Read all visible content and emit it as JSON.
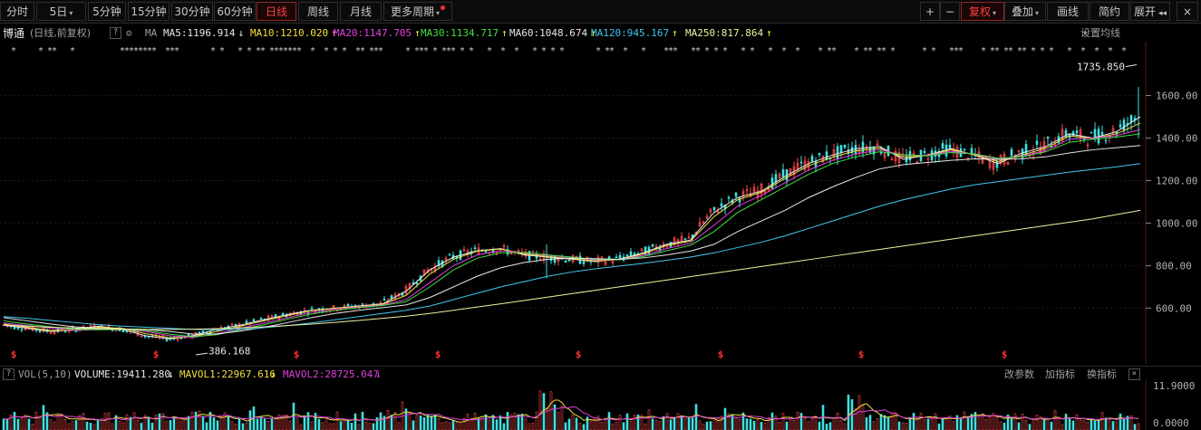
{
  "toolbar": {
    "periods": [
      {
        "label": "分时",
        "active": false
      },
      {
        "label": "5日",
        "active": false,
        "dropdown": true
      },
      {
        "label": "5分钟",
        "active": false
      },
      {
        "label": "15分钟",
        "active": false
      },
      {
        "label": "30分钟",
        "active": false
      },
      {
        "label": "60分钟",
        "active": false
      },
      {
        "label": "日线",
        "active": true
      },
      {
        "label": "周线",
        "active": false
      },
      {
        "label": "月线",
        "active": false
      },
      {
        "label": "更多周期",
        "active": false,
        "dropdown": true,
        "badge": true
      }
    ],
    "zoom_in": "+",
    "zoom_out": "−",
    "right": [
      {
        "label": "复权",
        "active": true,
        "dropdown": true
      },
      {
        "label": "叠加",
        "active": false,
        "dropdown": true
      },
      {
        "label": "画线",
        "active": false
      },
      {
        "label": "简约",
        "active": false
      },
      {
        "label": "展开",
        "active": false
      }
    ],
    "expand_glyph": "◂◂",
    "close_glyph": "×"
  },
  "header": {
    "name": "博通",
    "mode": "(日线,前复权)",
    "help": "?",
    "ma_label": "MA",
    "ma": [
      {
        "text": "MA5:1196.914",
        "arrow": "↓",
        "color": "#e8e8e8"
      },
      {
        "text": "MA10:1210.020",
        "arrow": "↑",
        "color": "#f0e040"
      },
      {
        "text": "MA20:1147.705",
        "arrow": "↑",
        "color": "#e040e0"
      },
      {
        "text": "MA30:1134.717",
        "arrow": "↑",
        "color": "#40e040"
      },
      {
        "text": "MA60:1048.674",
        "arrow": "↑",
        "color": "#e8e8e8"
      },
      {
        "text": "MA120:945.167",
        "arrow": "↑",
        "color": "#40c8f0"
      },
      {
        "text": "MA250:817.864",
        "arrow": "↑",
        "color": "#f0f0a0"
      }
    ],
    "settings": "设置均线"
  },
  "chart_data": [
    {
      "type": "line",
      "series_note": "daily candlestick with moving averages",
      "y_ticks": [
        600,
        800,
        1000,
        1200,
        1400,
        1600
      ],
      "ylim": [
        380,
        1760
      ],
      "annotations": [
        {
          "text": "1735.850",
          "kind": "max"
        },
        {
          "text": "386.168",
          "kind": "min"
        }
      ],
      "series": [
        {
          "name": "MA5",
          "color": "#e8e8e8",
          "values": [
            520,
            505,
            490,
            500,
            515,
            500,
            470,
            455,
            470,
            500,
            520,
            545,
            570,
            590,
            600,
            610,
            620,
            680,
            780,
            840,
            870,
            880,
            850,
            840,
            830,
            820,
            830,
            860,
            900,
            920,
            1050,
            1120,
            1150,
            1220,
            1280,
            1320,
            1350,
            1360,
            1300,
            1320,
            1350,
            1320,
            1280,
            1330,
            1360,
            1420,
            1400,
            1430,
            1500
          ]
        },
        {
          "name": "MA10",
          "color": "#f0e040",
          "values": [
            525,
            510,
            495,
            495,
            510,
            505,
            480,
            460,
            465,
            490,
            515,
            540,
            565,
            588,
            600,
            608,
            618,
            660,
            760,
            830,
            868,
            878,
            855,
            842,
            832,
            822,
            828,
            855,
            895,
            915,
            1030,
            1110,
            1145,
            1210,
            1270,
            1310,
            1340,
            1352,
            1310,
            1318,
            1345,
            1322,
            1290,
            1320,
            1352,
            1410,
            1398,
            1420,
            1470
          ]
        },
        {
          "name": "MA20",
          "color": "#e040e0",
          "values": [
            530,
            518,
            505,
            495,
            500,
            502,
            490,
            470,
            462,
            480,
            505,
            530,
            555,
            580,
            595,
            605,
            615,
            640,
            720,
            800,
            850,
            870,
            860,
            848,
            838,
            828,
            828,
            848,
            880,
            905,
            990,
            1080,
            1130,
            1190,
            1250,
            1295,
            1325,
            1345,
            1320,
            1318,
            1338,
            1325,
            1300,
            1315,
            1342,
            1395,
            1400,
            1412,
            1440
          ]
        },
        {
          "name": "MA30",
          "color": "#40e040",
          "values": [
            540,
            525,
            512,
            500,
            498,
            500,
            495,
            478,
            465,
            475,
            498,
            522,
            548,
            572,
            590,
            602,
            612,
            630,
            700,
            780,
            835,
            860,
            862,
            850,
            840,
            830,
            828,
            842,
            870,
            895,
            960,
            1050,
            1110,
            1170,
            1230,
            1280,
            1312,
            1336,
            1322,
            1316,
            1332,
            1326,
            1305,
            1312,
            1335,
            1380,
            1395,
            1405,
            1420
          ]
        },
        {
          "name": "MA60",
          "color": "#e8e8e8",
          "values": [
            555,
            540,
            525,
            512,
            505,
            502,
            500,
            490,
            478,
            478,
            492,
            510,
            532,
            555,
            575,
            590,
            602,
            615,
            650,
            700,
            750,
            790,
            815,
            830,
            835,
            832,
            830,
            836,
            850,
            868,
            900,
            960,
            1010,
            1060,
            1120,
            1170,
            1215,
            1255,
            1275,
            1285,
            1295,
            1302,
            1300,
            1302,
            1312,
            1330,
            1345,
            1355,
            1365
          ]
        },
        {
          "name": "MA120",
          "color": "#40c8f0",
          "values": [
            560,
            552,
            542,
            532,
            522,
            515,
            510,
            505,
            500,
            498,
            500,
            508,
            518,
            530,
            545,
            560,
            575,
            590,
            610,
            640,
            670,
            700,
            725,
            750,
            770,
            785,
            798,
            810,
            825,
            840,
            860,
            885,
            910,
            940,
            975,
            1010,
            1045,
            1080,
            1110,
            1135,
            1160,
            1180,
            1195,
            1210,
            1225,
            1240,
            1252,
            1265,
            1280
          ]
        },
        {
          "name": "MA250",
          "color": "#f0f0a0",
          "values": [
            520,
            515,
            510,
            506,
            503,
            501,
            500,
            500,
            501,
            503,
            507,
            512,
            518,
            525,
            533,
            542,
            552,
            562,
            575,
            590,
            605,
            620,
            636,
            652,
            668,
            684,
            700,
            716,
            732,
            748,
            764,
            780,
            796,
            812,
            828,
            844,
            860,
            876,
            892,
            908,
            924,
            940,
            956,
            972,
            988,
            1004,
            1020,
            1040,
            1060
          ]
        }
      ]
    },
    {
      "type": "bar",
      "y_ticks": [
        "11.9000",
        "0.0000"
      ],
      "ylim": [
        0,
        11.9
      ]
    }
  ],
  "volume": {
    "label": "VOL(5,10)",
    "volume": "VOLUME:19411.280",
    "volume_arrow": "↓",
    "mavol1": "MAVOL1:22967.616",
    "mavol1_arrow": "↓",
    "mavol2": "MAVOL2:28725.047",
    "mavol2_arrow": "↓",
    "actions": [
      "改参数",
      "加指标",
      "换指标"
    ],
    "close": "×",
    "help": "?"
  },
  "markers": {
    "dividend": "$",
    "star": "*"
  }
}
